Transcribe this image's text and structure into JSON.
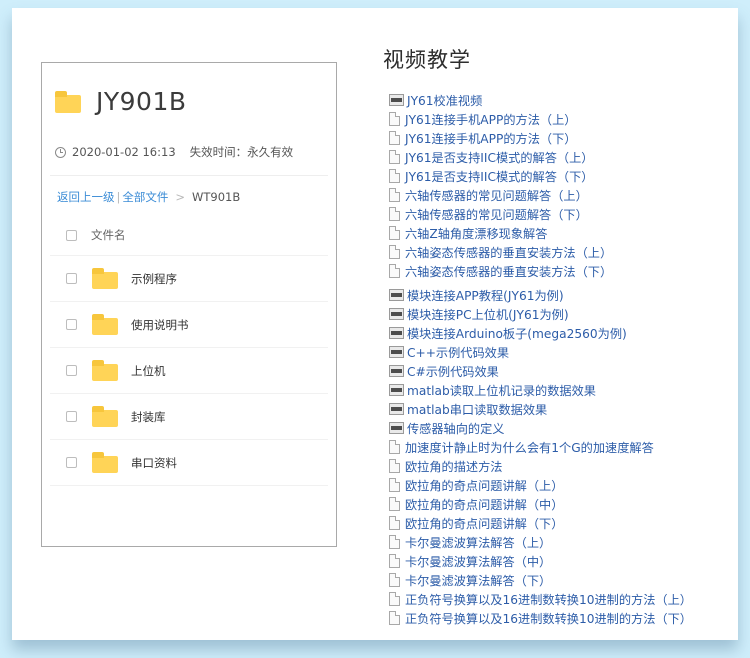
{
  "share": {
    "title": "JY901B",
    "date": "2020-01-02 16:13",
    "expire": "失效时间：永久有效",
    "breadcrumb": {
      "back": "返回上一级",
      "all": "全部文件",
      "current": "WT901B"
    },
    "column_header": "文件名",
    "folders": [
      "示例程序",
      "使用说明书",
      "上位机",
      "封装库",
      "串口资料"
    ]
  },
  "videos": {
    "title": "视频教学",
    "links": [
      {
        "label": "JY61校准视频",
        "icon": "html-file-icon"
      },
      {
        "label": "JY61连接手机APP的方法（上）",
        "icon": "document-icon"
      },
      {
        "label": "JY61连接手机APP的方法（下）",
        "icon": "document-icon"
      },
      {
        "label": "JY61是否支持IIC模式的解答（上）",
        "icon": "document-icon"
      },
      {
        "label": "JY61是否支持IIC模式的解答（下）",
        "icon": "document-icon"
      },
      {
        "label": "六轴传感器的常见问题解答（上）",
        "icon": "document-icon"
      },
      {
        "label": "六轴传感器的常见问题解答（下）",
        "icon": "document-icon"
      },
      {
        "label": "六轴Z轴角度漂移现象解答",
        "icon": "document-icon"
      },
      {
        "label": "六轴姿态传感器的垂直安装方法（上）",
        "icon": "document-icon"
      },
      {
        "label": "六轴姿态传感器的垂直安装方法（下）",
        "icon": "document-icon"
      },
      {
        "label": "模块连接APP教程(JY61为例)",
        "icon": "html-file-icon"
      },
      {
        "label": "模块连接PC上位机(JY61为例)",
        "icon": "html-file-icon"
      },
      {
        "label": "模块连接Arduino板子(mega2560为例)",
        "icon": "html-file-icon"
      },
      {
        "label": "C++示例代码效果",
        "icon": "html-file-icon"
      },
      {
        "label": "C#示例代码效果",
        "icon": "html-file-icon"
      },
      {
        "label": "matlab读取上位机记录的数据效果",
        "icon": "html-file-icon"
      },
      {
        "label": "matlab串口读取数据效果",
        "icon": "html-file-icon"
      },
      {
        "label": "传感器轴向的定义",
        "icon": "html-file-icon"
      },
      {
        "label": "加速度计静止时为什么会有1个G的加速度解答",
        "icon": "document-icon"
      },
      {
        "label": "欧拉角的描述方法",
        "icon": "document-icon"
      },
      {
        "label": "欧拉角的奇点问题讲解（上）",
        "icon": "document-icon"
      },
      {
        "label": "欧拉角的奇点问题讲解（中）",
        "icon": "document-icon"
      },
      {
        "label": "欧拉角的奇点问题讲解（下）",
        "icon": "document-icon"
      },
      {
        "label": "卡尔曼滤波算法解答（上）",
        "icon": "document-icon"
      },
      {
        "label": "卡尔曼滤波算法解答（中）",
        "icon": "document-icon"
      },
      {
        "label": "卡尔曼滤波算法解答（下）",
        "icon": "document-icon"
      },
      {
        "label": "正负符号换算以及16进制数转换10进制的方法（上）",
        "icon": "document-icon"
      },
      {
        "label": "正负符号换算以及16进制数转换10进制的方法（下）",
        "icon": "document-icon"
      }
    ]
  },
  "colors": {
    "link": "#2c5ca8",
    "breadcrumb_link": "#3b8cd6",
    "folder": "#ffd457",
    "background": "#cfeefb"
  }
}
